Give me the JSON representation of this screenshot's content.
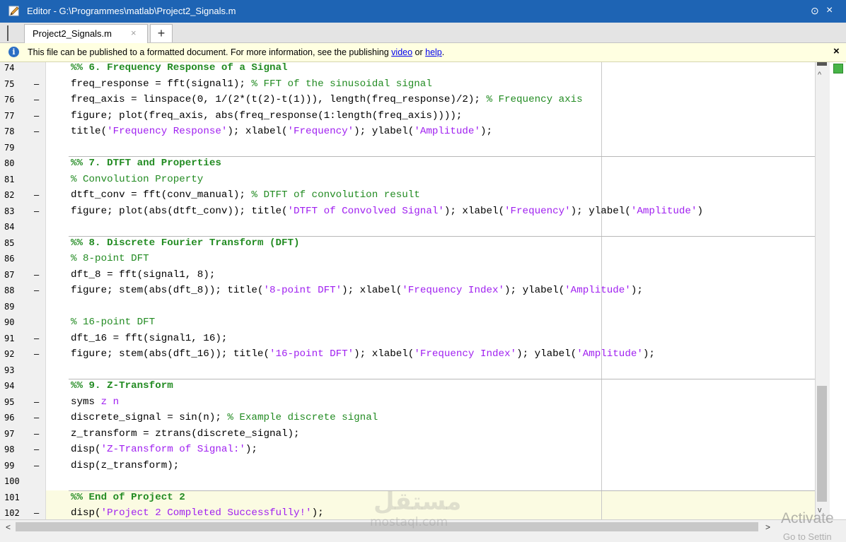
{
  "window": {
    "title": "Editor - G:\\Programmes\\matlab\\Project2_Signals.m",
    "minimize_glyph": "⊙",
    "close_glyph": "×"
  },
  "tabs": [
    {
      "label": "Project2_Signals.m",
      "close_glyph": "×"
    }
  ],
  "new_tab_label": "+",
  "infobar": {
    "icon": "info-icon",
    "icon_glyph": "i",
    "text_before": "This file can be published to a formatted document. For more information, see the publishing ",
    "link1": "video",
    "text_middle": " or ",
    "link2": "help",
    "text_after": ".",
    "close_glyph": "×"
  },
  "code_lines": [
    {
      "num": "74",
      "dash": false,
      "tokens": [
        {
          "t": "%% 6. Frequency Response of a Signal",
          "c": "h"
        }
      ]
    },
    {
      "num": "75",
      "dash": true,
      "tokens": [
        {
          "t": "freq_response = fft(signal1); ",
          "c": ""
        },
        {
          "t": "% FFT of the sinusoidal signal",
          "c": "c"
        }
      ]
    },
    {
      "num": "76",
      "dash": true,
      "tokens": [
        {
          "t": "freq_axis = linspace(0, 1/(2*(t(2)-t(1))), length(freq_response)/2); ",
          "c": ""
        },
        {
          "t": "% Frequency axis",
          "c": "c"
        }
      ]
    },
    {
      "num": "77",
      "dash": true,
      "tokens": [
        {
          "t": "figure; plot(freq_axis, abs(freq_response(1:length(freq_axis))));",
          "c": ""
        }
      ]
    },
    {
      "num": "78",
      "dash": true,
      "tokens": [
        {
          "t": "title(",
          "c": ""
        },
        {
          "t": "'Frequency Response'",
          "c": "s"
        },
        {
          "t": "); xlabel(",
          "c": ""
        },
        {
          "t": "'Frequency'",
          "c": "s"
        },
        {
          "t": "); ylabel(",
          "c": ""
        },
        {
          "t": "'Amplitude'",
          "c": "s"
        },
        {
          "t": ");",
          "c": ""
        }
      ]
    },
    {
      "num": "79",
      "dash": false,
      "tokens": []
    },
    {
      "num": "80",
      "dash": false,
      "tokens": [
        {
          "t": "%% 7. DTFT and Properties",
          "c": "h"
        }
      ]
    },
    {
      "num": "81",
      "dash": false,
      "tokens": [
        {
          "t": "% Convolution Property",
          "c": "c"
        }
      ]
    },
    {
      "num": "82",
      "dash": true,
      "tokens": [
        {
          "t": "dtft_conv = fft(conv_manual); ",
          "c": ""
        },
        {
          "t": "% DTFT of convolution result",
          "c": "c"
        }
      ]
    },
    {
      "num": "83",
      "dash": true,
      "tokens": [
        {
          "t": "figure; plot(abs(dtft_conv)); title(",
          "c": ""
        },
        {
          "t": "'DTFT of Convolved Signal'",
          "c": "s"
        },
        {
          "t": "); xlabel(",
          "c": ""
        },
        {
          "t": "'Frequency'",
          "c": "s"
        },
        {
          "t": "); ylabel(",
          "c": ""
        },
        {
          "t": "'Amplitude'",
          "c": "s"
        },
        {
          "t": ")",
          "c": ""
        }
      ]
    },
    {
      "num": "84",
      "dash": false,
      "tokens": []
    },
    {
      "num": "85",
      "dash": false,
      "tokens": [
        {
          "t": "%% 8. Discrete Fourier Transform (DFT)",
          "c": "h"
        }
      ]
    },
    {
      "num": "86",
      "dash": false,
      "tokens": [
        {
          "t": "% 8-point DFT",
          "c": "c"
        }
      ]
    },
    {
      "num": "87",
      "dash": true,
      "tokens": [
        {
          "t": "dft_8 = fft(signal1, 8);",
          "c": ""
        }
      ]
    },
    {
      "num": "88",
      "dash": true,
      "tokens": [
        {
          "t": "figure; stem(abs(dft_8)); title(",
          "c": ""
        },
        {
          "t": "'8-point DFT'",
          "c": "s"
        },
        {
          "t": "); xlabel(",
          "c": ""
        },
        {
          "t": "'Frequency Index'",
          "c": "s"
        },
        {
          "t": "); ylabel(",
          "c": ""
        },
        {
          "t": "'Amplitude'",
          "c": "s"
        },
        {
          "t": ");",
          "c": ""
        }
      ]
    },
    {
      "num": "89",
      "dash": false,
      "tokens": []
    },
    {
      "num": "90",
      "dash": false,
      "tokens": [
        {
          "t": "% 16-point DFT",
          "c": "c"
        }
      ]
    },
    {
      "num": "91",
      "dash": true,
      "tokens": [
        {
          "t": "dft_16 = fft(signal1, 16);",
          "c": ""
        }
      ]
    },
    {
      "num": "92",
      "dash": true,
      "tokens": [
        {
          "t": "figure; stem(abs(dft_16)); title(",
          "c": ""
        },
        {
          "t": "'16-point DFT'",
          "c": "s"
        },
        {
          "t": "); xlabel(",
          "c": ""
        },
        {
          "t": "'Frequency Index'",
          "c": "s"
        },
        {
          "t": "); ylabel(",
          "c": ""
        },
        {
          "t": "'Amplitude'",
          "c": "s"
        },
        {
          "t": ");",
          "c": ""
        }
      ]
    },
    {
      "num": "93",
      "dash": false,
      "tokens": []
    },
    {
      "num": "94",
      "dash": false,
      "tokens": [
        {
          "t": "%% 9. Z-Transform",
          "c": "h"
        }
      ]
    },
    {
      "num": "95",
      "dash": true,
      "tokens": [
        {
          "t": "syms ",
          "c": ""
        },
        {
          "t": "z n",
          "c": "s"
        }
      ]
    },
    {
      "num": "96",
      "dash": true,
      "tokens": [
        {
          "t": "discrete_signal = sin(n); ",
          "c": ""
        },
        {
          "t": "% Example discrete signal",
          "c": "c"
        }
      ]
    },
    {
      "num": "97",
      "dash": true,
      "tokens": [
        {
          "t": "z_transform = ztrans(discrete_signal);",
          "c": ""
        }
      ]
    },
    {
      "num": "98",
      "dash": true,
      "tokens": [
        {
          "t": "disp(",
          "c": ""
        },
        {
          "t": "'Z-Transform of Signal:'",
          "c": "s"
        },
        {
          "t": ");",
          "c": ""
        }
      ]
    },
    {
      "num": "99",
      "dash": true,
      "tokens": [
        {
          "t": "disp(z_transform);",
          "c": ""
        }
      ]
    },
    {
      "num": "100",
      "dash": false,
      "tokens": []
    },
    {
      "num": "101",
      "dash": false,
      "tokens": [
        {
          "t": "%% End of Project 2",
          "c": "h"
        }
      ]
    },
    {
      "num": "102",
      "dash": true,
      "tokens": [
        {
          "t": "disp(",
          "c": ""
        },
        {
          "t": "'Project 2 Completed Successfully!'",
          "c": "s"
        },
        {
          "t": ");",
          "c": ""
        }
      ]
    }
  ],
  "active_cell_start_line": "101",
  "colors": {
    "titlebar": "#1e64b4",
    "comment": "#228b22",
    "string": "#a020f0",
    "infobar": "#ffffe1",
    "active_cell": "#fbfbe2"
  },
  "scrollbar": {
    "up_glyph": "^",
    "down_glyph": "v",
    "left_glyph": "<",
    "right_glyph": ">"
  },
  "watermark": {
    "logo_text": "مستقل",
    "site_text": "mostaql.com"
  },
  "windows_activation": {
    "line1": "Activate",
    "line2": "Go to Settin"
  }
}
